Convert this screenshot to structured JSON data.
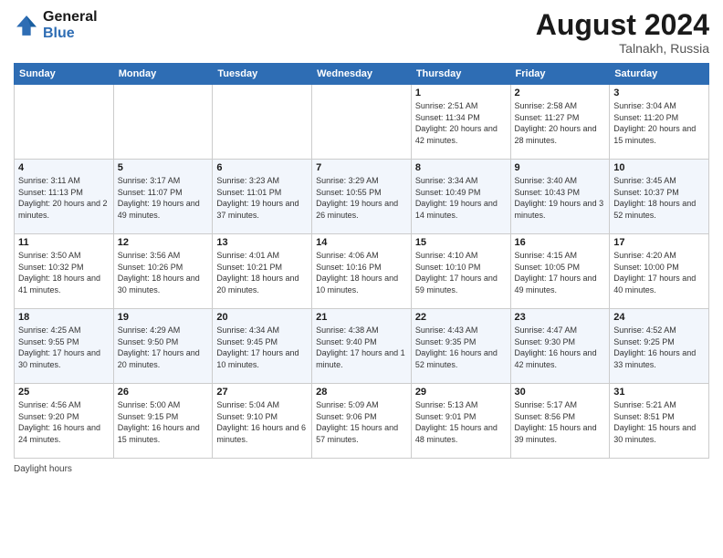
{
  "header": {
    "logo_line1": "General",
    "logo_line2": "Blue",
    "month": "August 2024",
    "location": "Talnakh, Russia"
  },
  "days_of_week": [
    "Sunday",
    "Monday",
    "Tuesday",
    "Wednesday",
    "Thursday",
    "Friday",
    "Saturday"
  ],
  "weeks": [
    [
      {
        "day": "",
        "sunrise": "",
        "sunset": "",
        "daylight": ""
      },
      {
        "day": "",
        "sunrise": "",
        "sunset": "",
        "daylight": ""
      },
      {
        "day": "",
        "sunrise": "",
        "sunset": "",
        "daylight": ""
      },
      {
        "day": "",
        "sunrise": "",
        "sunset": "",
        "daylight": ""
      },
      {
        "day": "1",
        "sunrise": "Sunrise: 2:51 AM",
        "sunset": "Sunset: 11:34 PM",
        "daylight": "Daylight: 20 hours and 42 minutes."
      },
      {
        "day": "2",
        "sunrise": "Sunrise: 2:58 AM",
        "sunset": "Sunset: 11:27 PM",
        "daylight": "Daylight: 20 hours and 28 minutes."
      },
      {
        "day": "3",
        "sunrise": "Sunrise: 3:04 AM",
        "sunset": "Sunset: 11:20 PM",
        "daylight": "Daylight: 20 hours and 15 minutes."
      }
    ],
    [
      {
        "day": "4",
        "sunrise": "Sunrise: 3:11 AM",
        "sunset": "Sunset: 11:13 PM",
        "daylight": "Daylight: 20 hours and 2 minutes."
      },
      {
        "day": "5",
        "sunrise": "Sunrise: 3:17 AM",
        "sunset": "Sunset: 11:07 PM",
        "daylight": "Daylight: 19 hours and 49 minutes."
      },
      {
        "day": "6",
        "sunrise": "Sunrise: 3:23 AM",
        "sunset": "Sunset: 11:01 PM",
        "daylight": "Daylight: 19 hours and 37 minutes."
      },
      {
        "day": "7",
        "sunrise": "Sunrise: 3:29 AM",
        "sunset": "Sunset: 10:55 PM",
        "daylight": "Daylight: 19 hours and 26 minutes."
      },
      {
        "day": "8",
        "sunrise": "Sunrise: 3:34 AM",
        "sunset": "Sunset: 10:49 PM",
        "daylight": "Daylight: 19 hours and 14 minutes."
      },
      {
        "day": "9",
        "sunrise": "Sunrise: 3:40 AM",
        "sunset": "Sunset: 10:43 PM",
        "daylight": "Daylight: 19 hours and 3 minutes."
      },
      {
        "day": "10",
        "sunrise": "Sunrise: 3:45 AM",
        "sunset": "Sunset: 10:37 PM",
        "daylight": "Daylight: 18 hours and 52 minutes."
      }
    ],
    [
      {
        "day": "11",
        "sunrise": "Sunrise: 3:50 AM",
        "sunset": "Sunset: 10:32 PM",
        "daylight": "Daylight: 18 hours and 41 minutes."
      },
      {
        "day": "12",
        "sunrise": "Sunrise: 3:56 AM",
        "sunset": "Sunset: 10:26 PM",
        "daylight": "Daylight: 18 hours and 30 minutes."
      },
      {
        "day": "13",
        "sunrise": "Sunrise: 4:01 AM",
        "sunset": "Sunset: 10:21 PM",
        "daylight": "Daylight: 18 hours and 20 minutes."
      },
      {
        "day": "14",
        "sunrise": "Sunrise: 4:06 AM",
        "sunset": "Sunset: 10:16 PM",
        "daylight": "Daylight: 18 hours and 10 minutes."
      },
      {
        "day": "15",
        "sunrise": "Sunrise: 4:10 AM",
        "sunset": "Sunset: 10:10 PM",
        "daylight": "Daylight: 17 hours and 59 minutes."
      },
      {
        "day": "16",
        "sunrise": "Sunrise: 4:15 AM",
        "sunset": "Sunset: 10:05 PM",
        "daylight": "Daylight: 17 hours and 49 minutes."
      },
      {
        "day": "17",
        "sunrise": "Sunrise: 4:20 AM",
        "sunset": "Sunset: 10:00 PM",
        "daylight": "Daylight: 17 hours and 40 minutes."
      }
    ],
    [
      {
        "day": "18",
        "sunrise": "Sunrise: 4:25 AM",
        "sunset": "Sunset: 9:55 PM",
        "daylight": "Daylight: 17 hours and 30 minutes."
      },
      {
        "day": "19",
        "sunrise": "Sunrise: 4:29 AM",
        "sunset": "Sunset: 9:50 PM",
        "daylight": "Daylight: 17 hours and 20 minutes."
      },
      {
        "day": "20",
        "sunrise": "Sunrise: 4:34 AM",
        "sunset": "Sunset: 9:45 PM",
        "daylight": "Daylight: 17 hours and 10 minutes."
      },
      {
        "day": "21",
        "sunrise": "Sunrise: 4:38 AM",
        "sunset": "Sunset: 9:40 PM",
        "daylight": "Daylight: 17 hours and 1 minute."
      },
      {
        "day": "22",
        "sunrise": "Sunrise: 4:43 AM",
        "sunset": "Sunset: 9:35 PM",
        "daylight": "Daylight: 16 hours and 52 minutes."
      },
      {
        "day": "23",
        "sunrise": "Sunrise: 4:47 AM",
        "sunset": "Sunset: 9:30 PM",
        "daylight": "Daylight: 16 hours and 42 minutes."
      },
      {
        "day": "24",
        "sunrise": "Sunrise: 4:52 AM",
        "sunset": "Sunset: 9:25 PM",
        "daylight": "Daylight: 16 hours and 33 minutes."
      }
    ],
    [
      {
        "day": "25",
        "sunrise": "Sunrise: 4:56 AM",
        "sunset": "Sunset: 9:20 PM",
        "daylight": "Daylight: 16 hours and 24 minutes."
      },
      {
        "day": "26",
        "sunrise": "Sunrise: 5:00 AM",
        "sunset": "Sunset: 9:15 PM",
        "daylight": "Daylight: 16 hours and 15 minutes."
      },
      {
        "day": "27",
        "sunrise": "Sunrise: 5:04 AM",
        "sunset": "Sunset: 9:10 PM",
        "daylight": "Daylight: 16 hours and 6 minutes."
      },
      {
        "day": "28",
        "sunrise": "Sunrise: 5:09 AM",
        "sunset": "Sunset: 9:06 PM",
        "daylight": "Daylight: 15 hours and 57 minutes."
      },
      {
        "day": "29",
        "sunrise": "Sunrise: 5:13 AM",
        "sunset": "Sunset: 9:01 PM",
        "daylight": "Daylight: 15 hours and 48 minutes."
      },
      {
        "day": "30",
        "sunrise": "Sunrise: 5:17 AM",
        "sunset": "Sunset: 8:56 PM",
        "daylight": "Daylight: 15 hours and 39 minutes."
      },
      {
        "day": "31",
        "sunrise": "Sunrise: 5:21 AM",
        "sunset": "Sunset: 8:51 PM",
        "daylight": "Daylight: 15 hours and 30 minutes."
      }
    ]
  ],
  "footer": {
    "label": "Daylight hours"
  }
}
